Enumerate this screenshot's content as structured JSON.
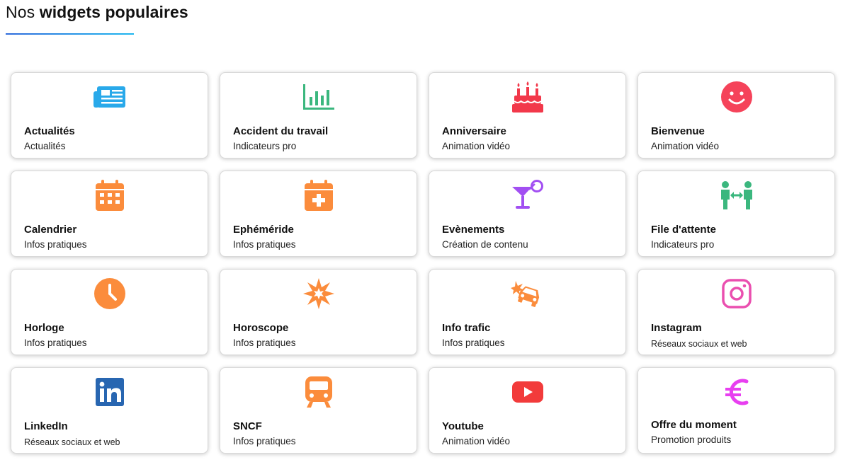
{
  "header": {
    "title_prefix": "Nos",
    "title_strong": "widgets populaires"
  },
  "widgets": [
    {
      "title": "Actualités",
      "subtitle": "Actualités",
      "icon": "newspaper-icon",
      "color": "#29a9ea"
    },
    {
      "title": "Accident du travail",
      "subtitle": "Indicateurs pro",
      "icon": "bar-chart-icon",
      "color": "#3bb77e"
    },
    {
      "title": "Anniversaire",
      "subtitle": "Animation vidéo",
      "icon": "birthday-cake-icon",
      "color": "#f2384a"
    },
    {
      "title": "Bienvenue",
      "subtitle": "Animation vidéo",
      "icon": "smiley-icon",
      "color": "#f5435a"
    },
    {
      "title": "Calendrier",
      "subtitle": "Infos pratiques",
      "icon": "calendar-icon",
      "color": "#fb8c3c"
    },
    {
      "title": "Ephéméride",
      "subtitle": "Infos pratiques",
      "icon": "calendar-plus-icon",
      "color": "#fb8c3c"
    },
    {
      "title": "Evènements",
      "subtitle": "Création de contenu",
      "icon": "cocktail-icon",
      "color": "#a24ff2"
    },
    {
      "title": "File d'attente",
      "subtitle": "Indicateurs pro",
      "icon": "queue-people-icon",
      "color": "#3bb77e"
    },
    {
      "title": "Horloge",
      "subtitle": "Infos pratiques",
      "icon": "clock-icon",
      "color": "#fb8c3c"
    },
    {
      "title": "Horoscope",
      "subtitle": "Infos pratiques",
      "icon": "sun-star-icon",
      "color": "#fb8c3c"
    },
    {
      "title": "Info trafic",
      "subtitle": "Infos pratiques",
      "icon": "car-crash-icon",
      "color": "#fb8c3c"
    },
    {
      "title": "Instagram",
      "subtitle": "Réseaux sociaux et web",
      "icon": "instagram-icon",
      "color": "#ea4faf"
    },
    {
      "title": "LinkedIn",
      "subtitle": "Réseaux sociaux et web",
      "icon": "linkedin-icon",
      "color": "#2866b1"
    },
    {
      "title": "SNCF",
      "subtitle": "Infos pratiques",
      "icon": "train-icon",
      "color": "#fb8c3c"
    },
    {
      "title": "Youtube",
      "subtitle": "Animation vidéo",
      "icon": "youtube-icon",
      "color": "#f23b3b"
    },
    {
      "title": "Offre du moment",
      "subtitle": "Promotion produits",
      "icon": "euro-icon",
      "color": "#e83ff0"
    }
  ]
}
